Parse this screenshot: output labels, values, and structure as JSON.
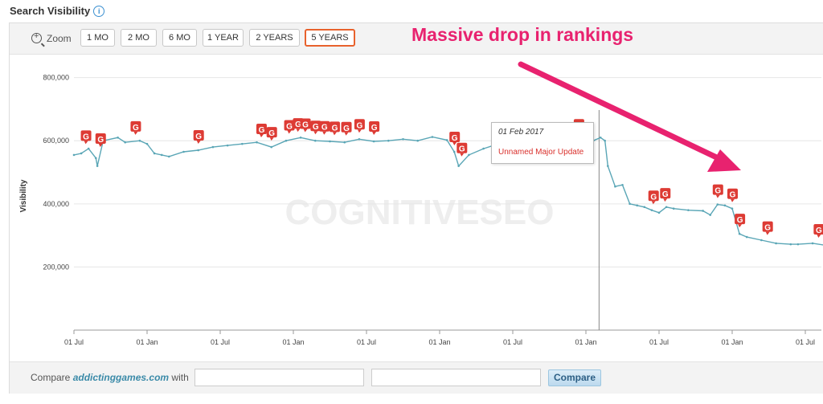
{
  "header": {
    "title": "Search Visibility",
    "info_icon": "info-icon"
  },
  "toolbar": {
    "zoom_label": "Zoom",
    "zoom_icon": "zoom-in-icon",
    "buttons": [
      "1 MO",
      "2 MO",
      "6 MO",
      "1 YEAR",
      "2 YEARS",
      "5 YEARS"
    ],
    "active": "5 YEARS"
  },
  "annotation": {
    "text": "Massive drop in rankings",
    "color": "#e8226f"
  },
  "watermark": "COGNITIVESEO",
  "tooltip": {
    "date": "01 Feb 2017",
    "name": "Unnamed Major Update"
  },
  "footer": {
    "compare_label": "Compare",
    "domain": "addictinggames.com",
    "with_label": "with",
    "button": "Compare"
  },
  "colors": {
    "line": "#5aa6b6",
    "marker": "#dd3b34",
    "active_border": "#e8622d",
    "arrow": "#e8226f"
  },
  "chart_data": {
    "type": "line",
    "ylabel": "Visibility",
    "ylim": [
      0,
      850000
    ],
    "yticks": [
      200000,
      400000,
      600000,
      800000
    ],
    "ytick_labels": [
      "200,000",
      "400,000",
      "600,000",
      "800,000"
    ],
    "xlim": [
      0,
      5
    ],
    "xticks": [
      0,
      0.5,
      1,
      1.5,
      2,
      2.5,
      3,
      3.5,
      4,
      4.5,
      5
    ],
    "xtick_labels": [
      "01 Jul",
      "01 Jan",
      "01 Jul",
      "01 Jan",
      "01 Jul",
      "01 Jan",
      "01 Jul",
      "01 Jan",
      "01 Jul",
      "01 Jan",
      "01 Jul"
    ],
    "grid": true,
    "crosshair_x": 3.59,
    "series": [
      {
        "points": [
          [
            0,
            555000
          ],
          [
            0.05,
            560000
          ],
          [
            0.1,
            575000
          ],
          [
            0.15,
            545000
          ],
          [
            0.16,
            520000
          ],
          [
            0.2,
            600000
          ],
          [
            0.3,
            610000
          ],
          [
            0.35,
            595000
          ],
          [
            0.45,
            600000
          ],
          [
            0.5,
            590000
          ],
          [
            0.55,
            560000
          ],
          [
            0.6,
            555000
          ],
          [
            0.65,
            550000
          ],
          [
            0.75,
            565000
          ],
          [
            0.85,
            570000
          ],
          [
            0.95,
            580000
          ],
          [
            1.05,
            585000
          ],
          [
            1.15,
            590000
          ],
          [
            1.25,
            595000
          ],
          [
            1.35,
            580000
          ],
          [
            1.45,
            600000
          ],
          [
            1.55,
            610000
          ],
          [
            1.65,
            600000
          ],
          [
            1.75,
            598000
          ],
          [
            1.85,
            595000
          ],
          [
            1.95,
            605000
          ],
          [
            2.05,
            598000
          ],
          [
            2.15,
            600000
          ],
          [
            2.25,
            605000
          ],
          [
            2.35,
            600000
          ],
          [
            2.45,
            612000
          ],
          [
            2.55,
            602000
          ],
          [
            2.6,
            565000
          ],
          [
            2.63,
            520000
          ],
          [
            2.7,
            555000
          ],
          [
            2.8,
            575000
          ],
          [
            2.9,
            590000
          ],
          [
            3.0,
            600000
          ],
          [
            3.1,
            612000
          ],
          [
            3.2,
            605000
          ],
          [
            3.25,
            595000
          ],
          [
            3.3,
            598000
          ],
          [
            3.35,
            610000
          ],
          [
            3.4,
            600000
          ],
          [
            3.45,
            605000
          ],
          [
            3.5,
            590000
          ],
          [
            3.55,
            600000
          ],
          [
            3.6,
            610000
          ],
          [
            3.63,
            600000
          ],
          [
            3.65,
            520000
          ],
          [
            3.7,
            455000
          ],
          [
            3.75,
            460000
          ],
          [
            3.8,
            400000
          ],
          [
            3.85,
            395000
          ],
          [
            3.9,
            390000
          ],
          [
            3.95,
            380000
          ],
          [
            4.0,
            372000
          ],
          [
            4.05,
            390000
          ],
          [
            4.1,
            385000
          ],
          [
            4.2,
            380000
          ],
          [
            4.3,
            378000
          ],
          [
            4.35,
            365000
          ],
          [
            4.4,
            398000
          ],
          [
            4.45,
            395000
          ],
          [
            4.5,
            385000
          ],
          [
            4.55,
            305000
          ],
          [
            4.6,
            295000
          ],
          [
            4.7,
            285000
          ],
          [
            4.8,
            275000
          ],
          [
            4.9,
            272000
          ],
          [
            4.95,
            272000
          ],
          [
            5.05,
            275000
          ],
          [
            5.15,
            268000
          ],
          [
            5.2,
            265000
          ],
          [
            5.25,
            255000
          ],
          [
            5.3,
            245000
          ],
          [
            5.32,
            210000
          ],
          [
            5.35,
            205000
          ],
          [
            5.4,
            250000
          ],
          [
            5.45,
            245000
          ],
          [
            5.5,
            240000
          ],
          [
            5.55,
            238000
          ],
          [
            5.6,
            245000
          ]
        ]
      }
    ],
    "update_markers": [
      0.08,
      0.18,
      0.42,
      0.85,
      1.28,
      1.35,
      1.47,
      1.53,
      1.58,
      1.65,
      1.71,
      1.78,
      1.86,
      1.95,
      2.05,
      2.6,
      2.65,
      2.93,
      3.25,
      3.45,
      3.96,
      4.04,
      4.4,
      4.5,
      4.55,
      4.74,
      5.09,
      5.35,
      5.42,
      5.47,
      5.52,
      5.85,
      5.96
    ]
  }
}
